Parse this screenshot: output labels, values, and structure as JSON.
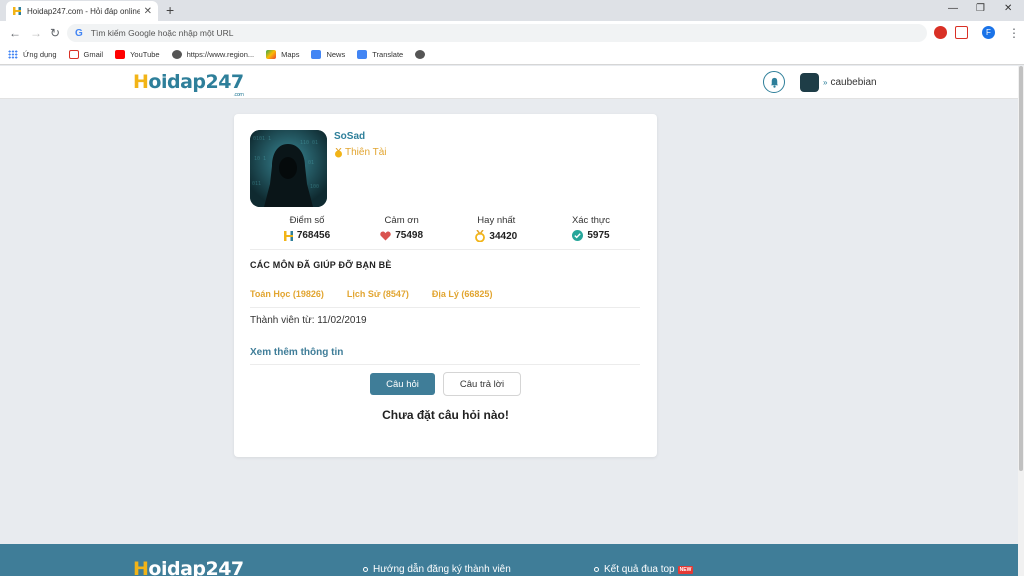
{
  "browser": {
    "tab_title": "Hoidap247.com - Hỏi đáp online",
    "omnibox_placeholder": "Tìm kiếm Google hoặc nhập một URL",
    "profile_letter": "F",
    "bookmarks": [
      {
        "label": "Ứng dụng",
        "icon": "apps-grid-icon"
      },
      {
        "label": "Gmail",
        "icon": "gmail-icon"
      },
      {
        "label": "YouTube",
        "icon": "youtube-icon"
      },
      {
        "label": "https://www.region...",
        "icon": "globe-icon"
      },
      {
        "label": "Maps",
        "icon": "maps-icon"
      },
      {
        "label": "News",
        "icon": "news-icon"
      },
      {
        "label": "Translate",
        "icon": "translate-icon"
      }
    ]
  },
  "header": {
    "logo": "oidap247",
    "logo_letter": "H",
    "logo_suffix": ".com",
    "username": "caubebian"
  },
  "profile": {
    "name": "SoSad",
    "rank": "Thiên Tài",
    "stats": [
      {
        "label": "Điểm số",
        "value": "768456",
        "icon": "h-logo-icon"
      },
      {
        "label": "Cảm ơn",
        "value": "75498",
        "icon": "heart-icon"
      },
      {
        "label": "Hay nhất",
        "value": "34420",
        "icon": "medal-icon"
      },
      {
        "label": "Xác thực",
        "value": "5975",
        "icon": "check-circle-icon"
      }
    ],
    "subjects_title": "CÁC MÔN ĐÃ GIÚP ĐỠ BẠN BÈ",
    "subjects": [
      "Toán Học (19826)",
      "Lịch Sử (8547)",
      "Địa Lý (66825)"
    ],
    "member_since": "Thành viên từ: 11/02/2019",
    "more_info": "Xem thêm thông tin",
    "tab_questions": "Câu hỏi",
    "tab_answers": "Câu trả lời",
    "empty_message": "Chưa đặt câu hỏi nào!"
  },
  "footer": {
    "logo": "oidap247",
    "logo_letter": "H",
    "link1": "Hướng dẫn đăng ký thành viên",
    "link2": "Kết quả đua top",
    "new_badge": "NEW"
  },
  "colors": {
    "brand": "#2e7f9a",
    "accent": "#f2b417",
    "button": "#3f7d98"
  }
}
